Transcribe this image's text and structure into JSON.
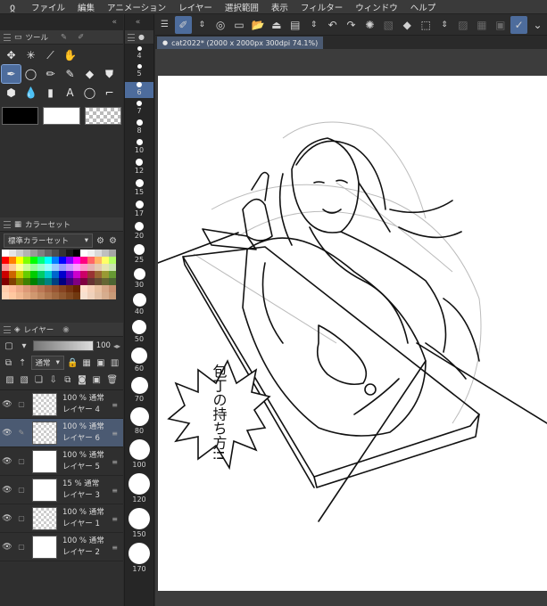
{
  "menubar": {
    "logo": "ჲ",
    "items": [
      "ファイル",
      "編集",
      "アニメーション",
      "レイヤー",
      "選択範囲",
      "表示",
      "フィルター",
      "ウィンドウ",
      "ヘルプ"
    ]
  },
  "tool_panel": {
    "tab_label": "ツール"
  },
  "color_set_panel": {
    "tab_label": "カラーセット",
    "set_name": "標準カラーセット"
  },
  "layer_panel": {
    "tab_label": "レイヤー",
    "blend_mode": "通常",
    "opacity": "100",
    "layers": [
      {
        "opacity_mode": "100 %  通常",
        "name": "レイヤー 4",
        "visible": true,
        "selected": false,
        "thumb": "checker"
      },
      {
        "opacity_mode": "100 %  通常",
        "name": "レイヤー 6",
        "visible": true,
        "selected": true,
        "thumb": "checker"
      },
      {
        "opacity_mode": "100 %  通常",
        "name": "レイヤー 5",
        "visible": true,
        "selected": false,
        "thumb": "sketch"
      },
      {
        "opacity_mode": "15 %  通常",
        "name": "レイヤー 3",
        "visible": true,
        "selected": false,
        "thumb": "sketch"
      },
      {
        "opacity_mode": "100 %  通常",
        "name": "レイヤー 1",
        "visible": true,
        "selected": false,
        "thumb": "checker"
      },
      {
        "opacity_mode": "100 %  通常",
        "name": "レイヤー 2",
        "visible": true,
        "selected": false,
        "thumb": "white"
      }
    ]
  },
  "brush_sizes": [
    {
      "label": "4"
    },
    {
      "label": "5"
    },
    {
      "label": "6"
    },
    {
      "label": "7"
    },
    {
      "label": "8"
    },
    {
      "label": "10"
    },
    {
      "label": "12"
    },
    {
      "label": "15"
    },
    {
      "label": "17"
    },
    {
      "label": "20"
    },
    {
      "label": "25"
    },
    {
      "label": "30"
    },
    {
      "label": "40"
    },
    {
      "label": "50"
    },
    {
      "label": "60"
    },
    {
      "label": "70"
    },
    {
      "label": "80"
    },
    {
      "label": "100"
    },
    {
      "label": "120"
    },
    {
      "label": "150"
    },
    {
      "label": "170"
    }
  ],
  "document": {
    "tab_title": "cat2022* (2000 x 2000px 300dpi 74.1%)"
  },
  "canvas": {
    "speech_bubble_text": "包丁の持ち方!!"
  },
  "colors": {
    "selection": "#4d6c9c",
    "layer_selected": "#4b5a72",
    "main_color": "#000000",
    "sub_color": "#ffffff"
  }
}
